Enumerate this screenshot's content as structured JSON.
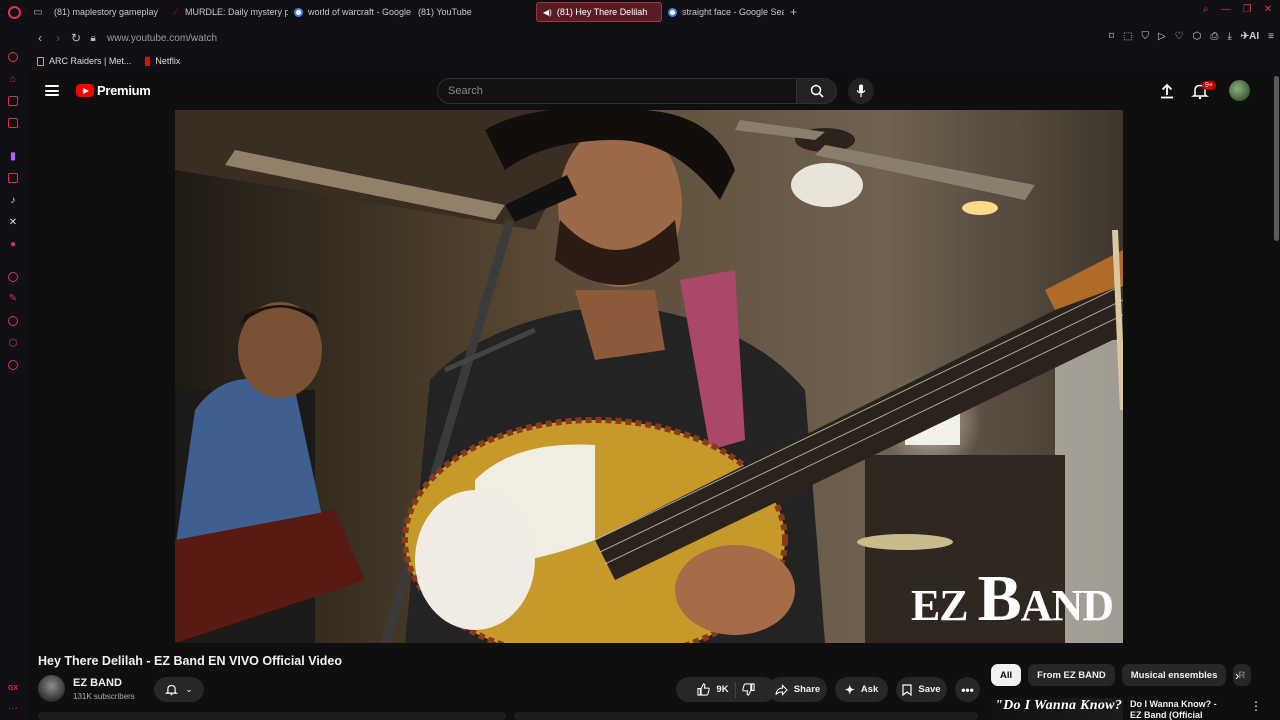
{
  "browser": {
    "tabs": [
      {
        "label": "(81) maplestory gameplay",
        "favicon": "youtube",
        "active": false
      },
      {
        "label": "MURDLE: Daily mystery p",
        "favicon": "murdle",
        "active": false
      },
      {
        "label": "world of warcraft - Google",
        "favicon": "google",
        "active": false
      },
      {
        "label": "(81) YouTube",
        "favicon": "youtube",
        "active": false
      },
      {
        "label": "(81) Hey There Delilah",
        "favicon": "youtube",
        "active": true,
        "playing": true
      },
      {
        "label": "straight face - Google Sea",
        "favicon": "google",
        "active": false
      }
    ],
    "url": "www.youtube.com/watch",
    "bookmarks": [
      {
        "label": "ARC Raiders | Met...",
        "icon": "arc-raiders-icon"
      },
      {
        "label": "Netflix",
        "icon": "netflix-icon"
      }
    ],
    "sidebar_footer": "GX",
    "ai_label": "AI",
    "accent_color": "#e0314b"
  },
  "youtube": {
    "logo_text": "Premium",
    "search_placeholder": "Search",
    "notification_badge": "9+",
    "video": {
      "watermark_prefix": "EZ ",
      "watermark_big": "B",
      "watermark_rest": "AND"
    },
    "title": "Hey There Delilah - EZ Band EN VIVO Official Video",
    "channel": {
      "name": "EZ BAND",
      "subscribers": "131K subscribers"
    },
    "actions": {
      "likes": "9K",
      "share": "Share",
      "ask": "Ask",
      "save": "Save"
    },
    "chips": [
      "All",
      "From EZ BAND",
      "Musical ensembles",
      "R"
    ],
    "recommendation": {
      "thumb_text": "\"Do I Wanna Know?\"",
      "title": "Do I Wanna Know? - EZ Band (Official Video)"
    }
  }
}
